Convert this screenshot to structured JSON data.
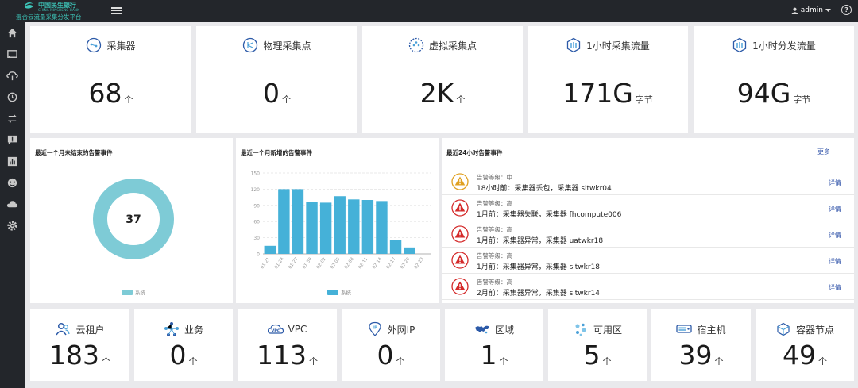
{
  "brand": {
    "name_cn": "中国民生银行",
    "name_en": "CHINA MINSHENG BANK",
    "subtitle": "混合云流量采集分发平台"
  },
  "header": {
    "user": "admin"
  },
  "sidebar": {
    "items": [
      {
        "icon": "home-icon"
      },
      {
        "icon": "screen-cast-icon"
      },
      {
        "icon": "cloud-link-icon"
      },
      {
        "icon": "history-icon"
      },
      {
        "icon": "swap-icon"
      },
      {
        "icon": "alert-message-icon"
      },
      {
        "icon": "bar-chart-icon"
      },
      {
        "icon": "dashboard-icon"
      },
      {
        "icon": "cloud-icon"
      },
      {
        "icon": "settings-icon"
      }
    ]
  },
  "top_stats": [
    {
      "label": "采集器",
      "value": "68",
      "unit": "个",
      "icon": "collector-icon"
    },
    {
      "label": "物理采集点",
      "value": "0",
      "unit": "个",
      "icon": "physical-point-icon"
    },
    {
      "label": "虚拟采集点",
      "value": "2K",
      "unit": "个",
      "icon": "virtual-point-icon"
    },
    {
      "label": "1小时采集流量",
      "value": "171G",
      "unit": "字节",
      "icon": "traffic-icon"
    },
    {
      "label": "1小时分发流量",
      "value": "94G",
      "unit": "字节",
      "icon": "distribute-icon"
    }
  ],
  "donut": {
    "title": "最近一个月未结束的告警事件",
    "value": "37",
    "legend": "系统",
    "color": "#7ecbd6"
  },
  "bar_panel": {
    "title": "最近一个月新增的告警事件",
    "legend": "系统",
    "color": "#45b1d8"
  },
  "chart_data": {
    "type": "bar",
    "categories": [
      "01-21",
      "01-24",
      "01-27",
      "01-30",
      "02-02",
      "02-05",
      "02-08",
      "02-11",
      "02-14",
      "02-17",
      "02-20",
      "02-23"
    ],
    "values": [
      15,
      120,
      120,
      97,
      95,
      107,
      101,
      100,
      98,
      25,
      12,
      0
    ],
    "yticks": [
      0,
      30,
      60,
      90,
      120,
      150
    ],
    "ylim": [
      0,
      150
    ],
    "series": [
      {
        "name": "系统"
      }
    ]
  },
  "alarms": {
    "title": "最近24小时告警事件",
    "more": "更多",
    "detail_label": "详情",
    "items": [
      {
        "level": "告警等级：中",
        "msg": "18小时前：采集器丢包，采集器 sitwkr04",
        "severity": "medium",
        "color": "#e0a020"
      },
      {
        "level": "告警等级：高",
        "msg": "1月前：采集器失联，采集器 fhcompute006",
        "severity": "high",
        "color": "#d42a2a"
      },
      {
        "level": "告警等级：高",
        "msg": "1月前：采集器异常，采集器 uatwkr18",
        "severity": "high",
        "color": "#d42a2a"
      },
      {
        "level": "告警等级：高",
        "msg": "1月前：采集器异常，采集器 sitwkr18",
        "severity": "high",
        "color": "#d42a2a"
      },
      {
        "level": "告警等级：高",
        "msg": "2月前：采集器异常，采集器 sitwkr14",
        "severity": "high",
        "color": "#d42a2a"
      }
    ]
  },
  "bottom_stats": [
    {
      "label": "云租户",
      "value": "183",
      "unit": "个",
      "icon": "tenant-icon"
    },
    {
      "label": "业务",
      "value": "0",
      "unit": "个",
      "icon": "business-icon"
    },
    {
      "label": "VPC",
      "value": "113",
      "unit": "个",
      "icon": "vpc-icon"
    },
    {
      "label": "外网IP",
      "value": "0",
      "unit": "个",
      "icon": "public-ip-icon"
    },
    {
      "label": "区域",
      "value": "1",
      "unit": "个",
      "icon": "region-icon"
    },
    {
      "label": "可用区",
      "value": "5",
      "unit": "个",
      "icon": "availability-zone-icon"
    },
    {
      "label": "宿主机",
      "value": "39",
      "unit": "个",
      "icon": "host-icon"
    },
    {
      "label": "容器节点",
      "value": "49",
      "unit": "个",
      "icon": "container-node-icon"
    }
  ]
}
